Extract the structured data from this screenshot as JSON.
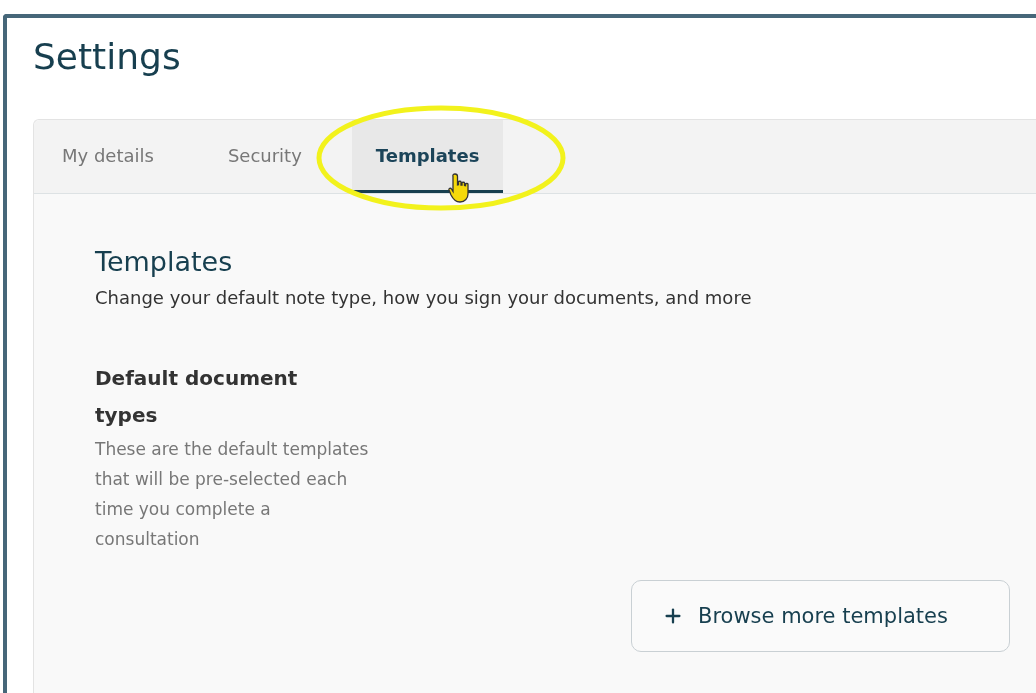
{
  "page": {
    "title": "Settings"
  },
  "tabs": [
    {
      "label": "My details",
      "selected": false
    },
    {
      "label": "Security",
      "selected": false
    },
    {
      "label": "Templates",
      "selected": true
    }
  ],
  "section": {
    "title": "Templates",
    "description": "Change your default note type, how you sign your documents, and more"
  },
  "setting": {
    "title": "Default document types",
    "description": "These are the default templates that will be pre-selected each time you complete a consultation"
  },
  "button": {
    "label": "Browse more templates"
  }
}
